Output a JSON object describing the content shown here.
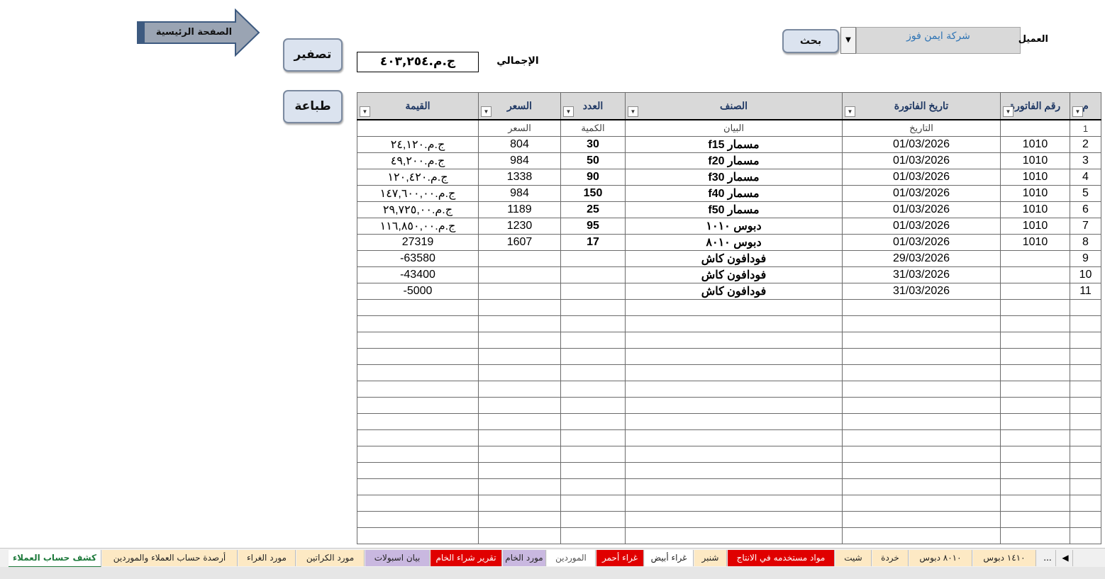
{
  "home_button": "الصفحة الرئيسية",
  "zero_button": "تصفير",
  "print_button": "طباعة",
  "search_button": "بحث",
  "total_label": "الإجمالي",
  "total_value": "ج.م.٤٠٣,٢٥٤",
  "client_label": "العميل",
  "client_value": "شركة ايمن فوز",
  "columns": {
    "num": "م",
    "invoice": "رقم الفاتورة",
    "date": "تاريخ الفاتورة",
    "item": "الصنف",
    "qty": "العدد",
    "price": "السعر",
    "value": "القيمة"
  },
  "rows": [
    {
      "n": "1",
      "inv": "",
      "date": "التاريخ",
      "item": "البيان",
      "qty": "الكمية",
      "price": "السعر",
      "val": ""
    },
    {
      "n": "2",
      "inv": "1010",
      "date": "01/03/2026",
      "item": "مسمار f15",
      "qty": "30",
      "price": "804",
      "val": "ج.م.٢٤,١٢٠"
    },
    {
      "n": "3",
      "inv": "1010",
      "date": "01/03/2026",
      "item": "مسمار f20",
      "qty": "50",
      "price": "984",
      "val": "ج.م.٤٩,٢٠٠"
    },
    {
      "n": "4",
      "inv": "1010",
      "date": "01/03/2026",
      "item": "مسمار f30",
      "qty": "90",
      "price": "1338",
      "val": "ج.م.١٢٠,٤٢٠"
    },
    {
      "n": "5",
      "inv": "1010",
      "date": "01/03/2026",
      "item": "مسمار f40",
      "qty": "150",
      "price": "984",
      "val": "ج.م.١٤٧,٦٠٠,٠٠"
    },
    {
      "n": "6",
      "inv": "1010",
      "date": "01/03/2026",
      "item": "مسمار f50",
      "qty": "25",
      "price": "1189",
      "val": "ج.م.٢٩,٧٢٥,٠٠"
    },
    {
      "n": "7",
      "inv": "1010",
      "date": "01/03/2026",
      "item": "دبوس ١٠١٠",
      "qty": "95",
      "price": "1230",
      "val": "ج.م.١١٦,٨٥٠,٠٠"
    },
    {
      "n": "8",
      "inv": "1010",
      "date": "01/03/2026",
      "item": "دبوس ٨٠١٠",
      "qty": "17",
      "price": "1607",
      "val": "27319"
    },
    {
      "n": "9",
      "inv": "",
      "date": "29/03/2026",
      "item": "فودافون كاش",
      "qty": "",
      "price": "",
      "val": "-63580"
    },
    {
      "n": "10",
      "inv": "",
      "date": "31/03/2026",
      "item": "فودافون كاش",
      "qty": "",
      "price": "",
      "val": "-43400"
    },
    {
      "n": "11",
      "inv": "",
      "date": "31/03/2026",
      "item": "فودافون كاش",
      "qty": "",
      "price": "",
      "val": "-5000"
    }
  ],
  "tabs": [
    {
      "label": "كشف حساب العملاء",
      "bg": "#ffffff",
      "fg": "#1e7a3c"
    },
    {
      "label": "أرصدة حساب العملاء والموردين",
      "bg": "#fde9c4",
      "fg": "#222222"
    },
    {
      "label": "مورد الغراء",
      "bg": "#fde9c4",
      "fg": "#222222"
    },
    {
      "label": "مورد الكراتين",
      "bg": "#fde9c4",
      "fg": "#222222"
    },
    {
      "label": "بيان اسبولات",
      "bg": "#c9b8e0",
      "fg": "#222222"
    },
    {
      "label": "تقرير شراء الخام",
      "bg": "#e00000",
      "fg": "#ffffff"
    },
    {
      "label": "مورد الخام",
      "bg": "#c9b8e0",
      "fg": "#222222"
    },
    {
      "label": "الموردين",
      "bg": "#ffffff",
      "fg": "#555555"
    },
    {
      "label": "غراء أحمر",
      "bg": "#e00000",
      "fg": "#ffffff"
    },
    {
      "label": "غراء أبيض",
      "bg": "#ffffff",
      "fg": "#222222"
    },
    {
      "label": "شنبر",
      "bg": "#fde9c4",
      "fg": "#222222"
    },
    {
      "label": "مواد مستخدمه في الانتاج",
      "bg": "#e00000",
      "fg": "#ffffff"
    },
    {
      "label": "شيت",
      "bg": "#fde9c4",
      "fg": "#222222"
    },
    {
      "label": "خردة",
      "bg": "#fde9c4",
      "fg": "#222222"
    },
    {
      "label": "٨٠١٠ دبوس",
      "bg": "#fde9c4",
      "fg": "#222222"
    },
    {
      "label": "١٤١٠ دبوس",
      "bg": "#fde9c4",
      "fg": "#222222"
    }
  ],
  "tab_more": "...",
  "icons": {
    "filter": "filter-dropdown-icon",
    "nav": "nav-arrow-icon"
  }
}
